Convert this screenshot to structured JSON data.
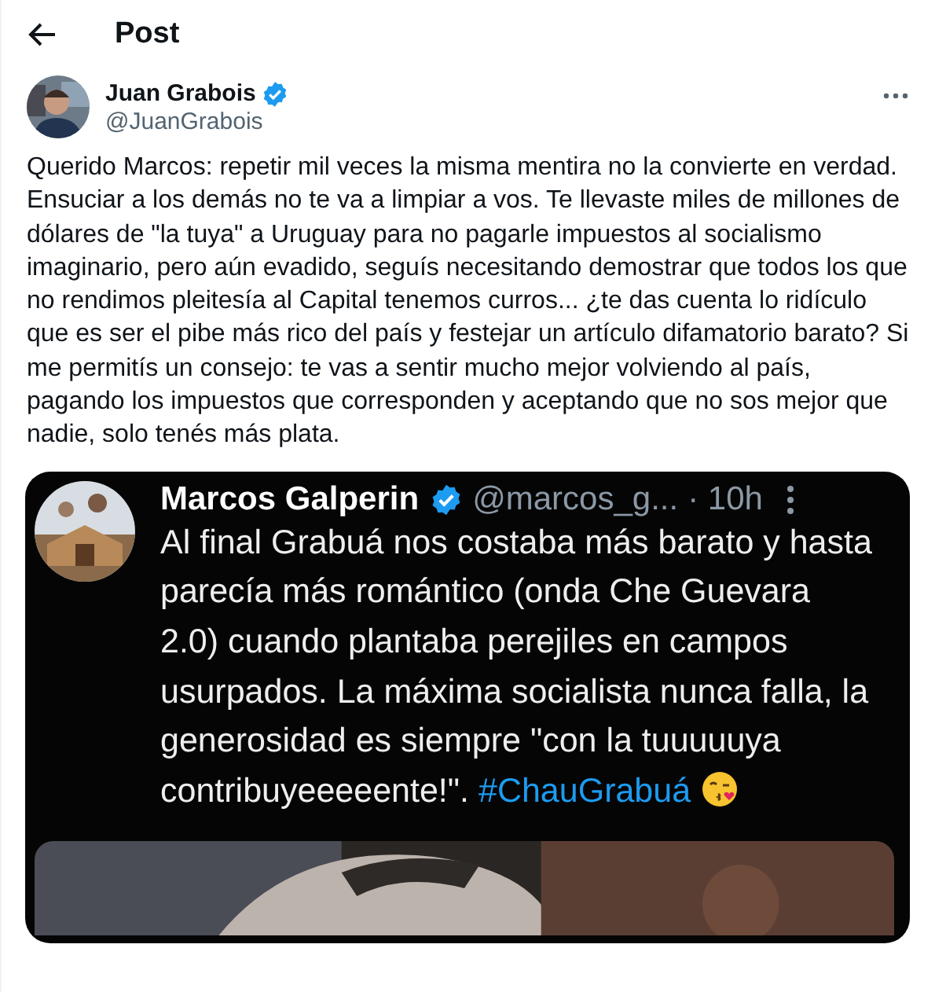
{
  "header": {
    "title": "Post"
  },
  "post": {
    "author": {
      "name": "Juan Grabois",
      "handle": "@JuanGrabois",
      "verified": true
    },
    "text": "Querido Marcos: repetir mil veces la misma mentira no la convierte en verdad. Ensuciar a los demás no te va a limpiar a vos. Te llevaste miles de millones de dólares de \"la tuya\" a Uruguay para no pagarle impuestos al socialismo imaginario, pero aún evadido, seguís necesitando demostrar que todos los que no rendimos pleitesía al Capital tenemos curros... ¿te das cuenta lo ridículo que es ser el pibe más rico del país y festejar un artículo difamatorio barato? Si me permitís un consejo: te vas a sentir mucho mejor volviendo al país, pagando los impuestos que corresponden y aceptando que no sos mejor que nadie, solo tenés más plata.",
    "quoted_screenshot": {
      "author": {
        "name": "Marcos Galperin",
        "handle": "@marcos_g...",
        "verified": true
      },
      "time": "· 10h",
      "text": "Al final Grabuá nos costaba más barato y hasta parecía más romántico (onda Che Guevara 2.0) cuando plantaba perejiles en campos usurpados. La máxima socialista nunca falla, la generosidad es siempre \"con la tuuuuuya contribuyeeeeente!\".",
      "hashtag": "#ChauGrabuá"
    }
  }
}
